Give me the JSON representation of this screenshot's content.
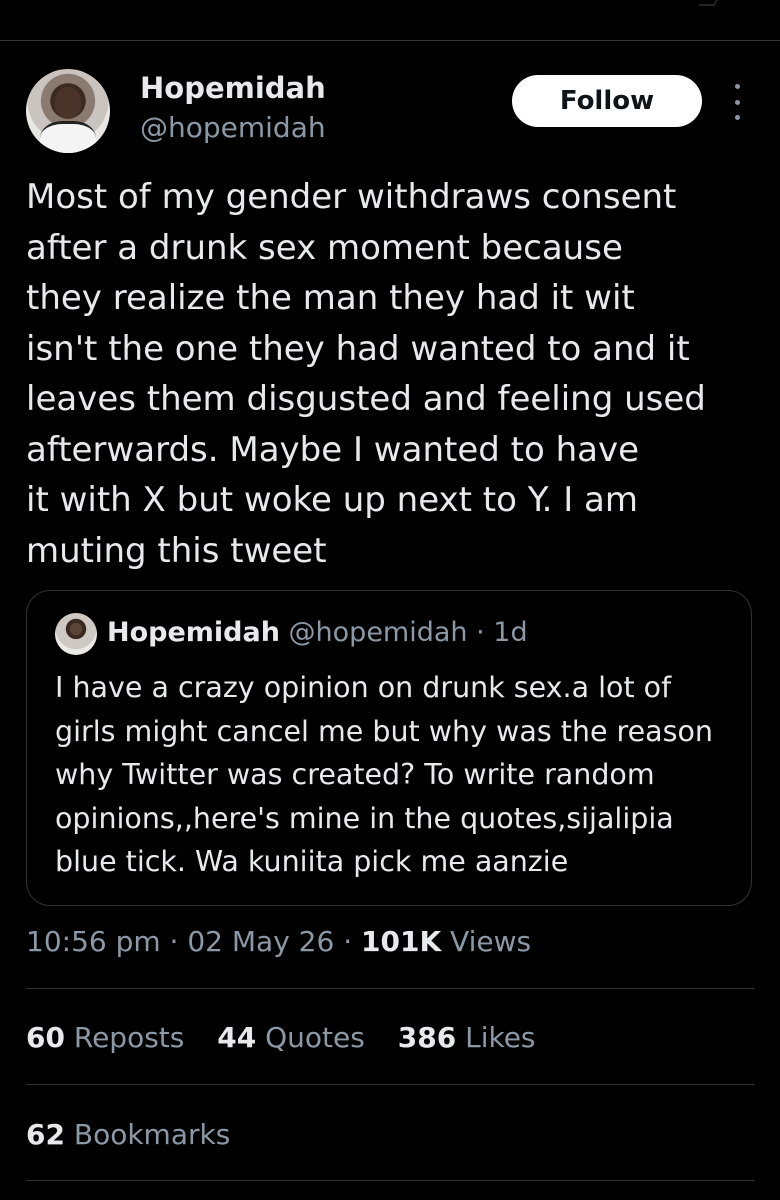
{
  "colors": {
    "background": "#000000",
    "text_primary": "#e7e9ea",
    "text_secondary": "#8b98a5",
    "divider": "#2f3336",
    "follow_button_bg": "#ffffff",
    "follow_button_text": "#0f1419"
  },
  "author": {
    "name": "Hopemidah",
    "handle": "@hopemidah",
    "avatar_icon": "profile-photo"
  },
  "follow_label": "Follow",
  "more_icon": "more-vertical-icon",
  "tweet": {
    "lines": [
      "Most of my gender withdraws consent",
      "after a drunk sex moment because",
      "they realize the man they had it wit",
      "isn't the one they had wanted to and it",
      "leaves them disgusted and feeling used",
      "afterwards. Maybe I wanted to have",
      "it with X but woke up next to Y. I am",
      "muting this tweet"
    ]
  },
  "quote": {
    "name": "Hopemidah",
    "handle": "@hopemidah",
    "age": "· 1d",
    "lines": [
      "I have a crazy opinion on drunk sex.a lot of",
      "girls might cancel me but why was the reason",
      "why Twitter was created? To write random",
      "opinions,,here's mine in the quotes,sijalipia",
      "blue tick. Wa kuniita pick me aanzie"
    ]
  },
  "meta": {
    "time": "10:56 pm",
    "sep1": " · ",
    "date": "02 May 26",
    "sep2": " · ",
    "views_count": "101K",
    "views_label": " Views"
  },
  "stats": {
    "reposts_count": "60",
    "reposts_label": " Reposts",
    "quotes_count": "44",
    "quotes_label": " Quotes",
    "likes_count": "386",
    "likes_label": " Likes",
    "bookmarks_count": "62",
    "bookmarks_label": " Bookmarks"
  }
}
